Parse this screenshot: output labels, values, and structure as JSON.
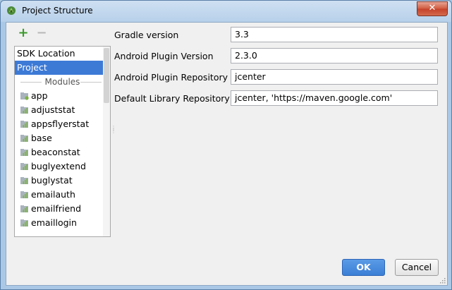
{
  "window": {
    "title": "Project Structure",
    "close_glyph": "✕"
  },
  "toolbar": {
    "add_label": "+",
    "remove_label": "−"
  },
  "sidebar": {
    "items": [
      {
        "label": "SDK Location"
      },
      {
        "label": "Project",
        "selected": true
      }
    ],
    "modules_header": "Modules",
    "modules": [
      "app",
      "adjuststat",
      "appsflyerstat",
      "base",
      "beaconstat",
      "buglyextend",
      "buglystat",
      "emailauth",
      "emailfriend",
      "emaillogin"
    ]
  },
  "form": {
    "rows": [
      {
        "label": "Gradle version",
        "value": "3.3"
      },
      {
        "label": "Android Plugin Version",
        "value": "2.3.0"
      },
      {
        "label": "Android Plugin Repository",
        "value": "jcenter"
      },
      {
        "label": "Default Library Repository",
        "value": "jcenter, 'https://maven.google.com'"
      }
    ]
  },
  "buttons": {
    "ok": "OK",
    "cancel": "Cancel"
  },
  "colors": {
    "selection": "#3d7ad6",
    "ok_button": "#3b7fd6",
    "add_icon": "#3a9a2a",
    "close_button": "#c4412a"
  }
}
